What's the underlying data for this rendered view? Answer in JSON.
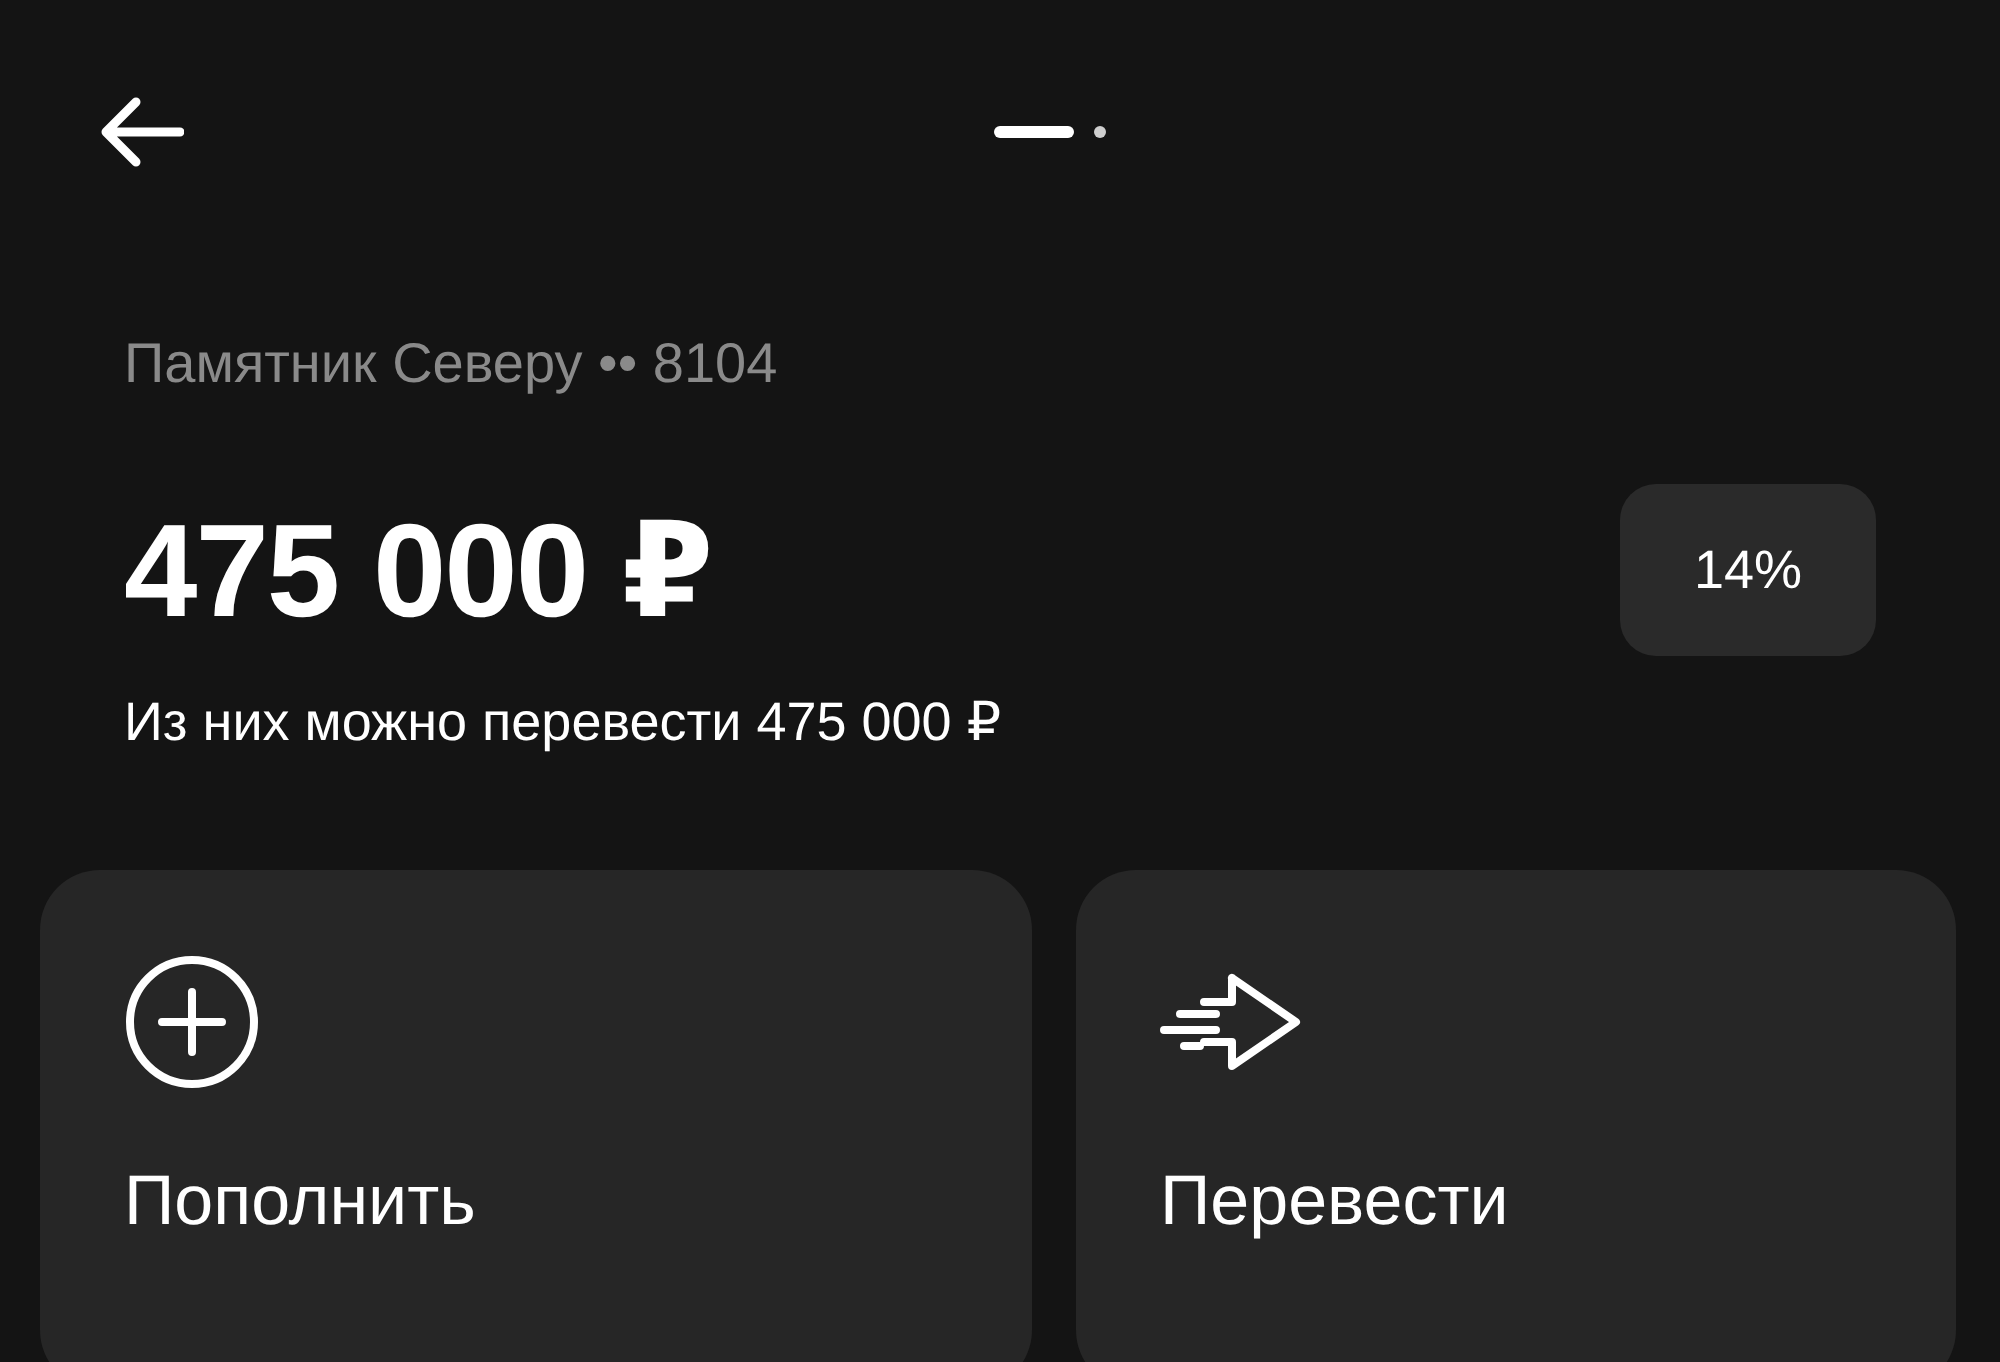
{
  "pager": [
    {
      "selected": true
    },
    {
      "selected": false
    }
  ],
  "account": {
    "name": "Памятник Северу •• 8104",
    "balance": "475 000 ₽",
    "rate": "14%",
    "available": "Из них можно перевести 475 000 ₽"
  },
  "actions": [
    {
      "kind": "add",
      "label": "Пополнить"
    },
    {
      "kind": "transfer",
      "label": "Перевести"
    }
  ]
}
